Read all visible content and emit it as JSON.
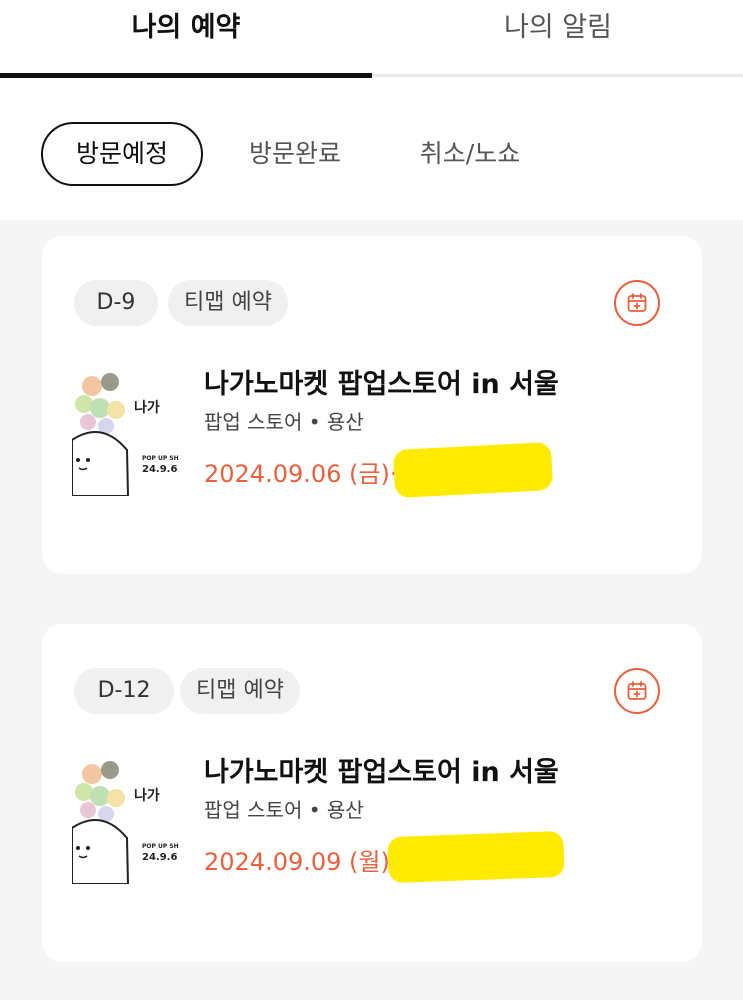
{
  "tabs": {
    "active": "나의 예약",
    "inactive": "나의 알림"
  },
  "filters": [
    "방문예정",
    "방문완료",
    "취소/노쇼"
  ],
  "reservations": [
    {
      "dday": "D-9",
      "type": "티맵 예약",
      "title": "나가노마켓 팝업스토어 in 서울",
      "subtitle": "팝업 스토어 • 용산",
      "date": "2024.09.06 (금)·"
    },
    {
      "dday": "D-12",
      "type": "티맵 예약",
      "title": "나가노마켓 팝업스토어 in 서울",
      "subtitle": "팝업 스토어 • 용산",
      "date": "2024.09.09 (월)"
    }
  ],
  "poster": {
    "logo_text": "나가",
    "line1": "POP UP SH",
    "line2": "24.9.6"
  },
  "colors": {
    "accent": "#e8603c",
    "redaction": "#ffea00"
  },
  "icons": {
    "calendar": "calendar-add-icon"
  }
}
